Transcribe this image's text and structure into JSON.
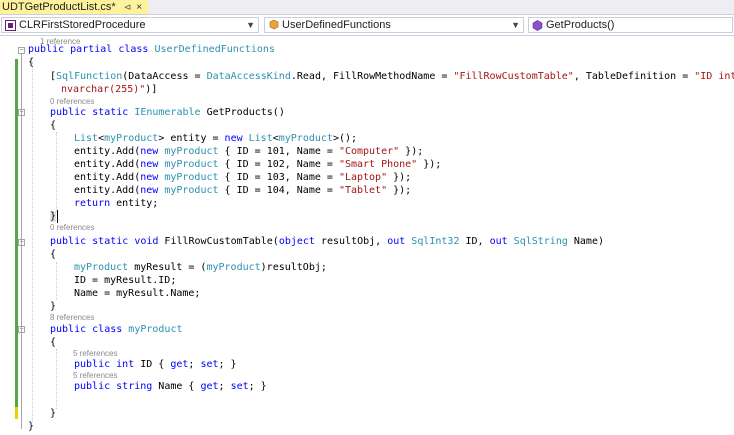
{
  "tab": {
    "title": "UDTGetProductList.cs*",
    "pin_glyph": "⊲",
    "close_glyph": "×"
  },
  "navbar": {
    "project": "CLRFirstStoredProcedure",
    "class": "UserDefinedFunctions",
    "member": "GetProducts()"
  },
  "colors": {
    "keyword": "#0000ff",
    "type": "#2b91af",
    "string": "#a31515",
    "tab_active": "#fff29d",
    "saved_change": "#57a64a",
    "unsaved_change": "#e8d200"
  },
  "codelens": {
    "l0": "1 reference",
    "l1": "0 references",
    "l2": "0 references",
    "l3": "8 references",
    "l4": "5 references",
    "l5": "5 references"
  },
  "code": {
    "c1_kw1": "public",
    "c1_kw2": "partial",
    "c1_kw3": "class",
    "c1_ty": "UserDefinedFunctions",
    "c2": "{",
    "c3_a": "[",
    "c3_ty1": "SqlFunction",
    "c3_b": "(DataAccess = ",
    "c3_ty2": "DataAccessKind",
    "c3_c": ".Read, FillRowMethodName = ",
    "c3_s1": "\"FillRowCustomTable\"",
    "c3_d": ", TableDefinition = ",
    "c3_s2": "\"ID int,Name",
    "c4_s": "nvarchar(255)\"",
    "c4_b": ")]",
    "c5_kw1": "public",
    "c5_kw2": "static",
    "c5_ty": "IEnumerable",
    "c5_rest": " GetProducts()",
    "c6": "{",
    "c7_ty1": "List",
    "c7_a": "<",
    "c7_ty2": "myProduct",
    "c7_b": "> entity = ",
    "c7_kw": "new",
    "c7_ty3": "List",
    "c7_c": "<",
    "c7_ty4": "myProduct",
    "c7_d": ">();",
    "add_a": "entity.Add(",
    "add_kw": "new",
    "add_ty": "myProduct",
    "add_b": " { ID = ",
    "r1_id": "101",
    "r1_mid": ", Name = ",
    "r1_s": "\"Computer\"",
    "r1_end": " });",
    "r2_id": "102",
    "r2_mid": ", Name = ",
    "r2_s": "\"Smart Phone\"",
    "r2_end": " });",
    "r3_id": "103",
    "r3_mid": ", Name = ",
    "r3_s": "\"Laptop\"",
    "r3_end": " });",
    "r4_id": "104",
    "r4_mid": ", Name = ",
    "r4_s": "\"Tablet\"",
    "r4_end": " });",
    "c12_kw": "return",
    "c12_rest": " entity;",
    "c13": "}",
    "c14_kw1": "public",
    "c14_kw2": "static",
    "c14_kw3": "void",
    "c14_a": " FillRowCustomTable(",
    "c14_kw4": "object",
    "c14_b": " resultObj, ",
    "c14_kw5": "out",
    "c14_ty1": "SqlInt32",
    "c14_c": " ID, ",
    "c14_kw6": "out",
    "c14_ty2": "SqlString",
    "c14_d": " Name)",
    "c15": "{",
    "c16_ty1": "myProduct",
    "c16_a": " myResult = (",
    "c16_ty2": "myProduct",
    "c16_b": ")resultObj;",
    "c17": "ID = myResult.ID;",
    "c18": "Name = myResult.Name;",
    "c19": "}",
    "c20_kw1": "public",
    "c20_kw2": "class",
    "c20_ty": "myProduct",
    "c21": "{",
    "c22_kw1": "public",
    "c22_kw2": "int",
    "c22_a": " ID { ",
    "c22_kw3": "get",
    "c22_b": "; ",
    "c22_kw4": "set",
    "c22_c": "; }",
    "c23_kw1": "public",
    "c23_kw2": "string",
    "c23_a": " Name { ",
    "c23_kw3": "get",
    "c23_b": "; ",
    "c23_kw4": "set",
    "c23_c": "; }",
    "c24": "}",
    "c25": "}"
  }
}
